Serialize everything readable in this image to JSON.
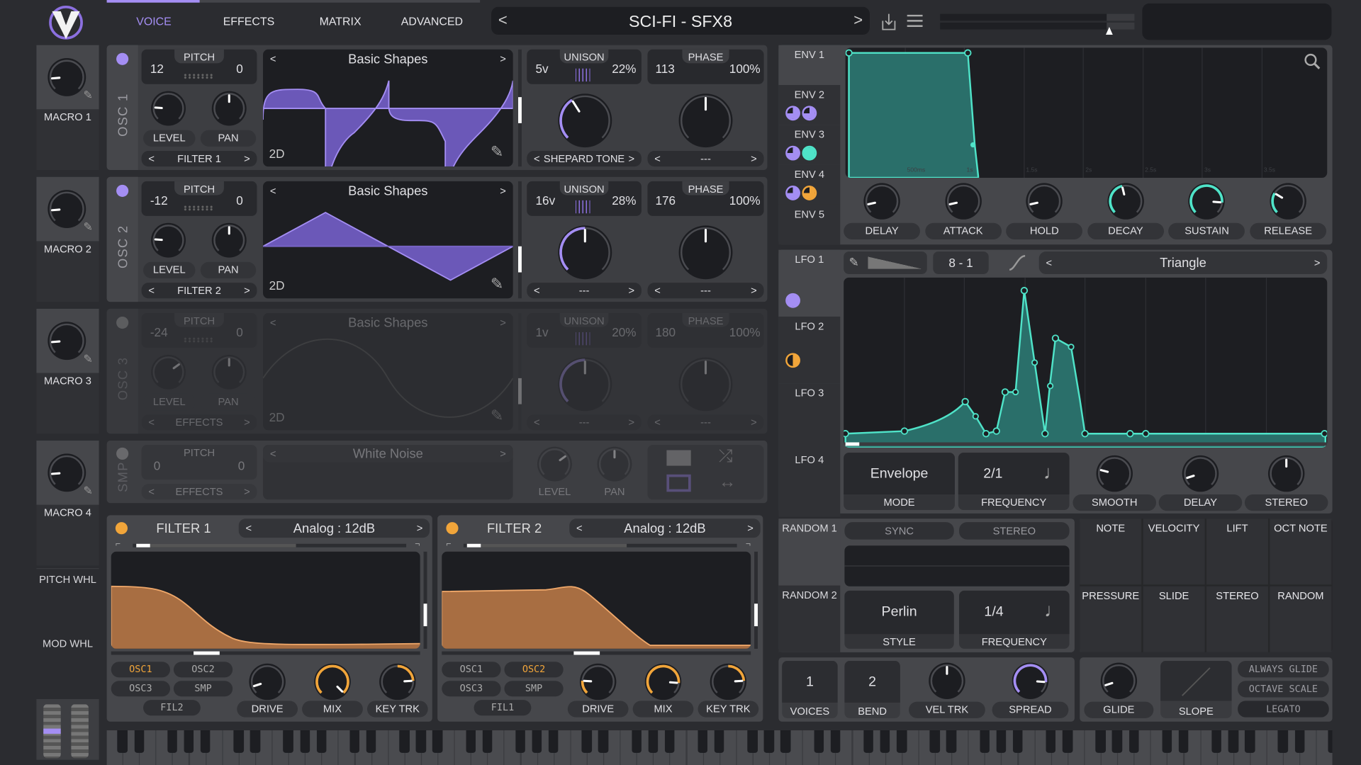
{
  "colors": {
    "purple": "#a48ef3",
    "teal": "#4fe3c8",
    "orange": "#f1a53a",
    "track": "#4a4b50",
    "bg": "#2b2c30"
  },
  "header": {
    "tabs": [
      {
        "label": "VOICE",
        "active": true
      },
      {
        "label": "EFFECTS"
      },
      {
        "label": "MATRIX"
      },
      {
        "label": "ADVANCED"
      }
    ],
    "preset": "SCI-FI - SFX8",
    "prev": "<",
    "next": ">",
    "save_icon": "download-icon",
    "menu_icon": "menu-icon"
  },
  "macros": [
    {
      "label": "MACRO 1",
      "value": 0.15
    },
    {
      "label": "MACRO 2",
      "value": 0.15
    },
    {
      "label": "MACRO 3",
      "value": 0.15
    },
    {
      "label": "MACRO 4",
      "value": 0.15
    }
  ],
  "wheels": {
    "pitch": "PITCH WHL",
    "mod": "MOD WHL"
  },
  "oscillators": [
    {
      "name": "OSC 1",
      "enabled": true,
      "pitch_label": "PITCH",
      "transpose": "12",
      "tune": "0",
      "level": 0.18,
      "pan": 0.5,
      "level_label": "LEVEL",
      "pan_label": "PAN",
      "destination": "FILTER 1",
      "wavetable": "Basic Shapes",
      "mode": "2D",
      "unison_label": "UNISON",
      "voices": "5v",
      "detune": "22%",
      "unison_knob": 0.38,
      "phase_label": "PHASE",
      "phase": "113",
      "phase_rand": "100%",
      "phase_knob": 0.5,
      "spectral": "SHEPARD TONE",
      "distortion": "---"
    },
    {
      "name": "OSC 2",
      "enabled": true,
      "pitch_label": "PITCH",
      "transpose": "-12",
      "tune": "0",
      "level": 0.18,
      "pan": 0.5,
      "level_label": "LEVEL",
      "pan_label": "PAN",
      "destination": "FILTER 2",
      "wavetable": "Basic Shapes",
      "mode": "2D",
      "unison_label": "UNISON",
      "voices": "16v",
      "detune": "28%",
      "unison_knob": 0.5,
      "phase_label": "PHASE",
      "phase": "176",
      "phase_rand": "100%",
      "phase_knob": 0.5,
      "spectral": "---",
      "distortion": "---"
    },
    {
      "name": "OSC 3",
      "enabled": false,
      "pitch_label": "PITCH",
      "transpose": "-24",
      "tune": "0",
      "level": 0.7,
      "pan": 0.5,
      "level_label": "LEVEL",
      "pan_label": "PAN",
      "destination": "EFFECTS",
      "wavetable": "Basic Shapes",
      "mode": "2D",
      "unison_label": "UNISON",
      "voices": "1v",
      "detune": "20%",
      "unison_knob": 0.5,
      "phase_label": "PHASE",
      "phase": "180",
      "phase_rand": "100%",
      "phase_knob": 0.5,
      "spectral": "---",
      "distortion": "---"
    }
  ],
  "sampler": {
    "name": "SMP",
    "enabled": false,
    "pitch_label": "PITCH",
    "transpose": "0",
    "tune": "0",
    "destination": "EFFECTS",
    "sample": "White Noise",
    "level": 0.7,
    "pan": 0.5,
    "level_label": "LEVEL",
    "pan_label": "PAN"
  },
  "filters": [
    {
      "title": "FILTER 1",
      "enabled": true,
      "model": "Analog : 12dB",
      "sources": [
        "OSC1",
        "OSC2",
        "OSC3",
        "SMP"
      ],
      "active_sources": [
        "OSC1"
      ],
      "chain": "FIL2",
      "drive": 0.1,
      "mix": 1.0,
      "key_track": 0.82,
      "drive_label": "DRIVE",
      "mix_label": "MIX",
      "keytrk_label": "KEY TRK"
    },
    {
      "title": "FILTER 2",
      "enabled": true,
      "model": "Analog : 12dB",
      "sources": [
        "OSC1",
        "OSC2",
        "OSC3",
        "SMP"
      ],
      "active_sources": [
        "OSC2"
      ],
      "chain": "FIL1",
      "drive": 0.18,
      "mix": 0.85,
      "key_track": 0.82,
      "drive_label": "DRIVE",
      "mix_label": "MIX",
      "keytrk_label": "KEY TRK"
    }
  ],
  "envelopes": {
    "tabs": [
      "ENV 1",
      "ENV 2",
      "ENV 3",
      "ENV 4",
      "ENV 5"
    ],
    "active": "ENV 1",
    "time_ticks": [
      "500ms",
      "1s",
      "1.5s",
      "2s",
      "2.5s",
      "3s",
      "3.5s"
    ],
    "knobs": [
      {
        "label": "DELAY",
        "value": 0.12
      },
      {
        "label": "ATTACK",
        "value": 0.12
      },
      {
        "label": "HOLD",
        "value": 0.12
      },
      {
        "label": "DECAY",
        "value": 0.45
      },
      {
        "label": "SUSTAIN",
        "value": 0.85
      },
      {
        "label": "RELEASE",
        "value": 0.28
      }
    ]
  },
  "lfos": {
    "tabs": [
      "LFO 1",
      "LFO 2",
      "LFO 3",
      "LFO 4"
    ],
    "active": "LFO 1",
    "grid": "8 - 1",
    "shape": "Triangle",
    "mode": "Envelope",
    "mode_label": "MODE",
    "frequency": "2/1",
    "frequency_label": "FREQUENCY",
    "knobs": [
      {
        "label": "SMOOTH",
        "value": 0.22
      },
      {
        "label": "DELAY",
        "value": 0.1
      },
      {
        "label": "STEREO",
        "value": 0.5
      }
    ]
  },
  "random": {
    "tabs": [
      "RANDOM 1",
      "RANDOM 2"
    ],
    "sync": "SYNC",
    "stereo": "STEREO",
    "style": "Perlin",
    "style_label": "STYLE",
    "frequency": "1/4",
    "frequency_label": "FREQUENCY"
  },
  "mod_sources": [
    "NOTE",
    "VELOCITY",
    "LIFT",
    "OCT NOTE",
    "PRESSURE",
    "SLIDE",
    "STEREO",
    "RANDOM"
  ],
  "voice": {
    "voices": "1",
    "voices_label": "VOICES",
    "bend": "2",
    "bend_label": "BEND",
    "vel_trk": 0.5,
    "vel_trk_label": "VEL TRK",
    "spread": 0.85,
    "spread_label": "SPREAD"
  },
  "glide": {
    "glide": 0.1,
    "glide_label": "GLIDE",
    "slope_label": "SLOPE",
    "always_glide": "ALWAYS GLIDE",
    "octave_scale": "OCTAVE SCALE",
    "legato": "LEGATO"
  }
}
